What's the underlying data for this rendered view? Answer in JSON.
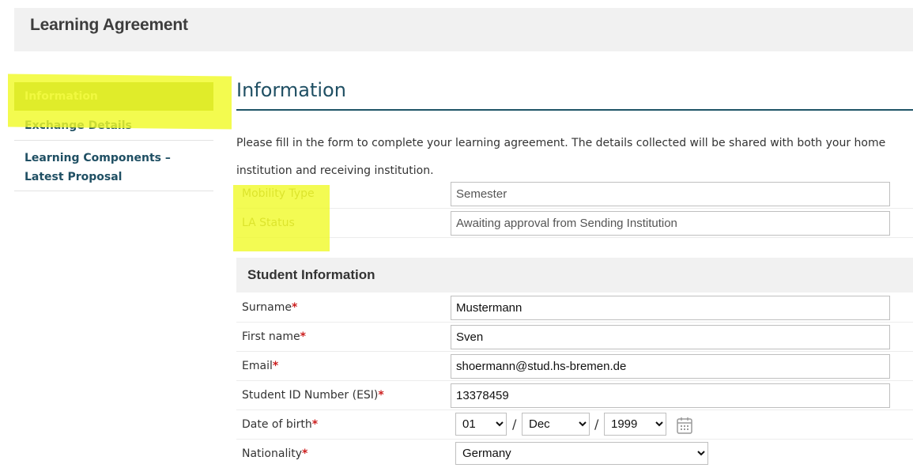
{
  "header": {
    "title": "Learning Agreement"
  },
  "sidebar": {
    "items": [
      {
        "label": "Information"
      },
      {
        "label": "Exchange Details"
      },
      {
        "label_line1": "Learning Components –",
        "label_line2": "Latest Proposal"
      }
    ]
  },
  "main": {
    "title": "Information",
    "intro": "Please fill in the form to complete your learning agreement. The details collected will be shared with both your home institution and receiving institution.",
    "mobility_type": {
      "label": "Mobility Type",
      "value": "Semester"
    },
    "la_status": {
      "label": "LA Status",
      "value": "Awaiting approval from Sending Institution"
    }
  },
  "student_info": {
    "section_title": "Student Information",
    "required_marker": "*",
    "surname": {
      "label": "Surname",
      "value": "Mustermann"
    },
    "first_name": {
      "label": "First name",
      "value": "Sven"
    },
    "email": {
      "label": "Email",
      "value": "shoermann@stud.hs-bremen.de"
    },
    "student_id": {
      "label": "Student ID Number (ESI)",
      "value": "13378459"
    },
    "dob": {
      "label": "Date of birth",
      "day": "01",
      "month": "Dec",
      "year": "1999",
      "separator": "/"
    },
    "nationality": {
      "label": "Nationality",
      "value": "Germany"
    }
  },
  "colors": {
    "accent": "#1f4f63",
    "active_nav": "#97ad35",
    "highlight": "#f0fa28",
    "required": "#cc1f1f"
  },
  "icons": {
    "calendar": "calendar-icon"
  }
}
